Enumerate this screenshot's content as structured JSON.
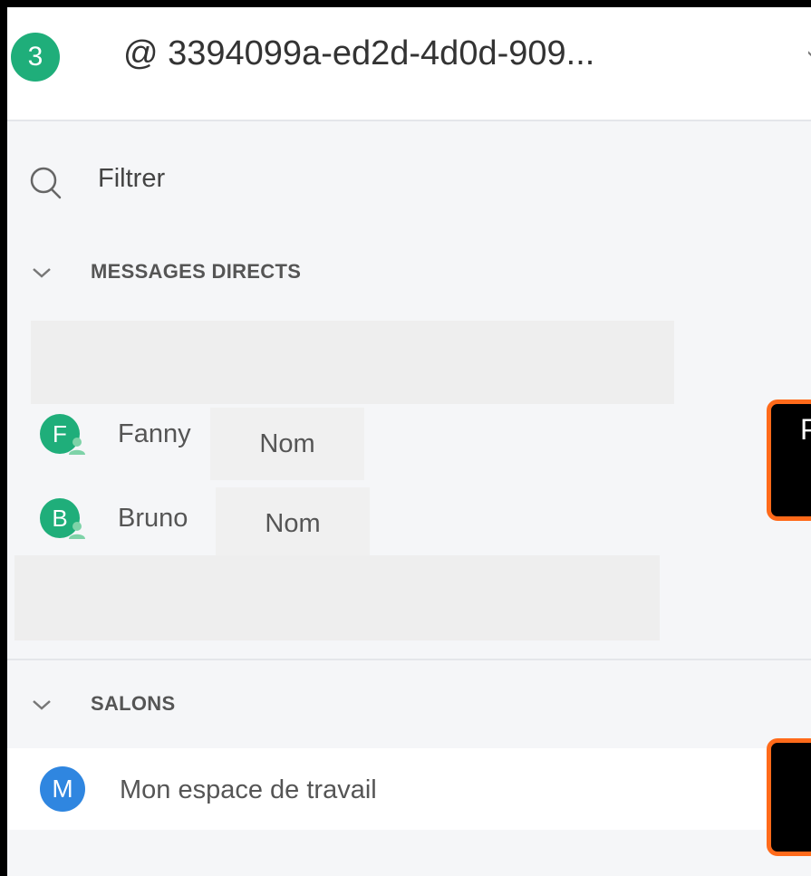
{
  "header": {
    "badge_count": "3",
    "title": "@ 3394099a-ed2d-4d0d-909..."
  },
  "filter": {
    "label": "Filtrer"
  },
  "sections": {
    "direct_messages": "MESSAGES DIRECTS",
    "rooms": "SALONS"
  },
  "direct_messages": [
    {
      "initial": "F",
      "name": "Fanny",
      "label": "Nom"
    },
    {
      "initial": "B",
      "name": "Bruno",
      "label": "Nom"
    }
  ],
  "rooms": [
    {
      "initial": "M",
      "name": "Mon espace de travail"
    }
  ],
  "callouts": [
    {
      "text": "P"
    },
    {
      "text": ""
    }
  ],
  "colors": {
    "green": "#1fae7a",
    "blue": "#2f86e0",
    "callout_border": "#ff6a1a"
  }
}
